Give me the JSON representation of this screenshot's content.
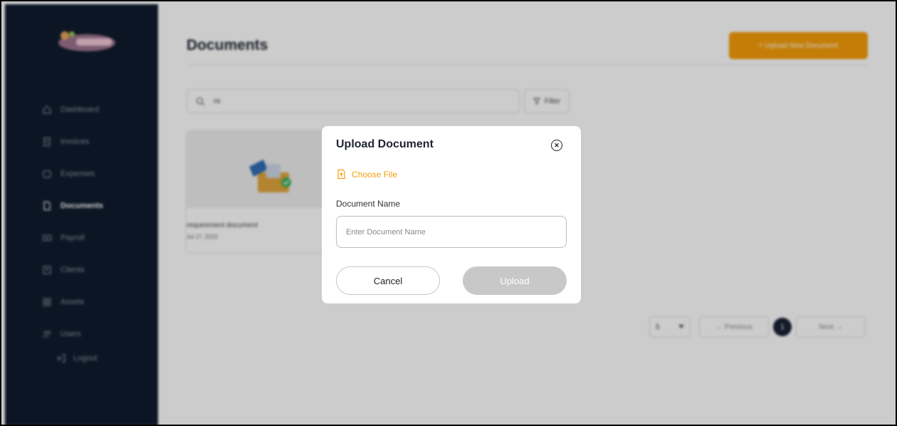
{
  "colors": {
    "sidebar_bg": "#0f1b2d",
    "accent": "#f59e0b",
    "upload_disabled": "#c8c8c8"
  },
  "sidebar": {
    "items": [
      {
        "label": "Dashboard",
        "icon": "home-icon"
      },
      {
        "label": "Invoices",
        "icon": "invoice-icon"
      },
      {
        "label": "Expenses",
        "icon": "wallet-icon"
      },
      {
        "label": "Documents",
        "icon": "document-icon",
        "active": true
      },
      {
        "label": "Payroll",
        "icon": "payroll-icon"
      },
      {
        "label": "Clients",
        "icon": "clients-icon"
      },
      {
        "label": "Assets",
        "icon": "assets-icon"
      },
      {
        "label": "Users",
        "icon": "users-icon"
      }
    ],
    "logout": "Logout"
  },
  "header": {
    "title": "Documents",
    "upload_new_label": "+ Upload New Document"
  },
  "search": {
    "value": "re"
  },
  "filter_label": "Filter",
  "documents": [
    {
      "name": "requirement document",
      "date": "Jul 17, 2023"
    }
  ],
  "pagination": {
    "per_page": "5",
    "previous": "← Previous",
    "current_page": "1",
    "next": "Next →"
  },
  "modal": {
    "title": "Upload Document",
    "choose_file": "Choose File",
    "doc_name_label": "Document Name",
    "doc_name_placeholder": "Enter Document Name",
    "doc_name_value": "",
    "cancel": "Cancel",
    "upload": "Upload"
  }
}
